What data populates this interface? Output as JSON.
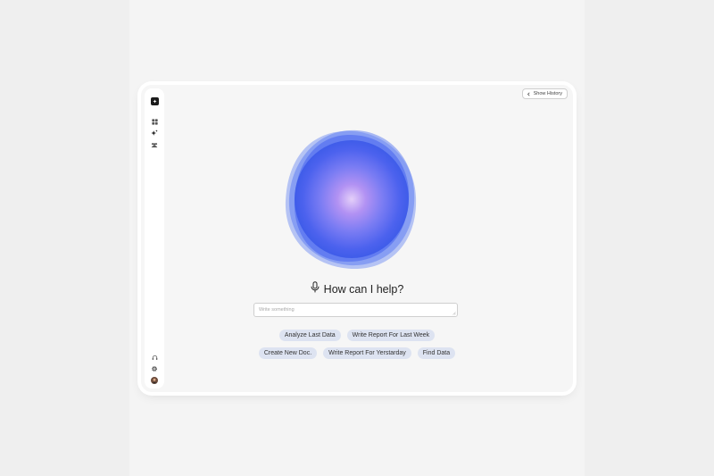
{
  "sidebar": {
    "logo_icon": "logo-icon",
    "nav_icons": [
      "grid-icon",
      "sparkle-icon",
      "people-icon"
    ],
    "bottom_icons": [
      "headset-icon",
      "gear-icon",
      "avatar"
    ]
  },
  "header": {
    "history_label": "Show History",
    "history_icon": "chevron-left-icon"
  },
  "assistant": {
    "heading": "How can I help?",
    "heading_icon": "microphone-icon",
    "input_placeholder": "Write something",
    "input_value": ""
  },
  "suggestions": {
    "row1": [
      "Analyze Last Data",
      "Write Report For Last Week"
    ],
    "row2": [
      "Create New Doc.",
      "Write Report For Yerstarday",
      "Find Data"
    ]
  },
  "colors": {
    "orb_primary": "#3f63ec",
    "orb_center": "#d9c2f7",
    "chip_bg": "#dde3f1"
  }
}
